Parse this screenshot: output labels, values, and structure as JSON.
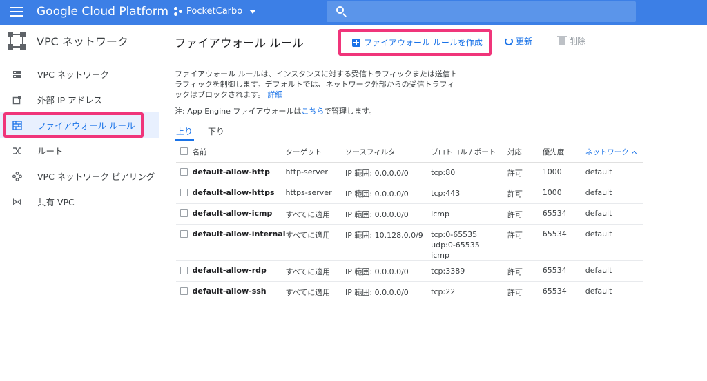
{
  "header": {
    "app_title": "Google Cloud Platform",
    "project_name": "PocketCarbo",
    "search_placeholder": ""
  },
  "sidebar": {
    "title": "VPC ネットワーク",
    "items": [
      {
        "label": "VPC ネットワーク",
        "icon": "vpc-network-icon"
      },
      {
        "label": "外部 IP アドレス",
        "icon": "external-ip-icon"
      },
      {
        "label": "ファイアウォール ルール",
        "icon": "firewall-icon",
        "active": true
      },
      {
        "label": "ルート",
        "icon": "route-icon"
      },
      {
        "label": "VPC ネットワーク ピアリング",
        "icon": "peering-icon"
      },
      {
        "label": "共有 VPC",
        "icon": "shared-vpc-icon"
      }
    ]
  },
  "main": {
    "page_title": "ファイアウォール ルール",
    "create_label": "ファイアウォール ルールを作成",
    "refresh_label": "更新",
    "delete_label": "削除",
    "description": "ファイアウォール ルールは、インスタンスに対する受信トラフィックまたは送信トラフィックを制御します。デフォルトでは、ネットワーク外部からの受信トラフィックはブロックされます。",
    "details_link": "詳細",
    "note_prefix": "注: App Engine ファイアウォールは",
    "note_link": "こちら",
    "note_suffix": "で管理します。",
    "tabs": [
      "上り",
      "下り"
    ],
    "columns": [
      "名前",
      "ターゲット",
      "ソースフィルタ",
      "プロトコル / ポート",
      "対応",
      "優先度",
      "ネットワーク"
    ],
    "rows": [
      {
        "name": "default-allow-http",
        "target": "http-server",
        "source": "IP 範囲: 0.0.0.0/0",
        "proto": [
          "tcp:80"
        ],
        "action": "許可",
        "priority": "1000",
        "network": "default"
      },
      {
        "name": "default-allow-https",
        "target": "https-server",
        "source": "IP 範囲: 0.0.0.0/0",
        "proto": [
          "tcp:443"
        ],
        "action": "許可",
        "priority": "1000",
        "network": "default"
      },
      {
        "name": "default-allow-icmp",
        "target": "すべてに適用",
        "source": "IP 範囲: 0.0.0.0/0",
        "proto": [
          "icmp"
        ],
        "action": "許可",
        "priority": "65534",
        "network": "default"
      },
      {
        "name": "default-allow-internal",
        "target": "すべてに適用",
        "source": "IP 範囲: 10.128.0.0/9",
        "proto": [
          "tcp:0-65535",
          "udp:0-65535",
          "icmp"
        ],
        "action": "許可",
        "priority": "65534",
        "network": "default"
      },
      {
        "name": "default-allow-rdp",
        "target": "すべてに適用",
        "source": "IP 範囲: 0.0.0.0/0",
        "proto": [
          "tcp:3389"
        ],
        "action": "許可",
        "priority": "65534",
        "network": "default"
      },
      {
        "name": "default-allow-ssh",
        "target": "すべてに適用",
        "source": "IP 範囲: 0.0.0.0/0",
        "proto": [
          "tcp:22"
        ],
        "action": "許可",
        "priority": "65534",
        "network": "default"
      }
    ]
  },
  "colors": {
    "topbar": "#3c7fe6",
    "accent": "#1a73e8",
    "highlight": "#f0357a"
  }
}
